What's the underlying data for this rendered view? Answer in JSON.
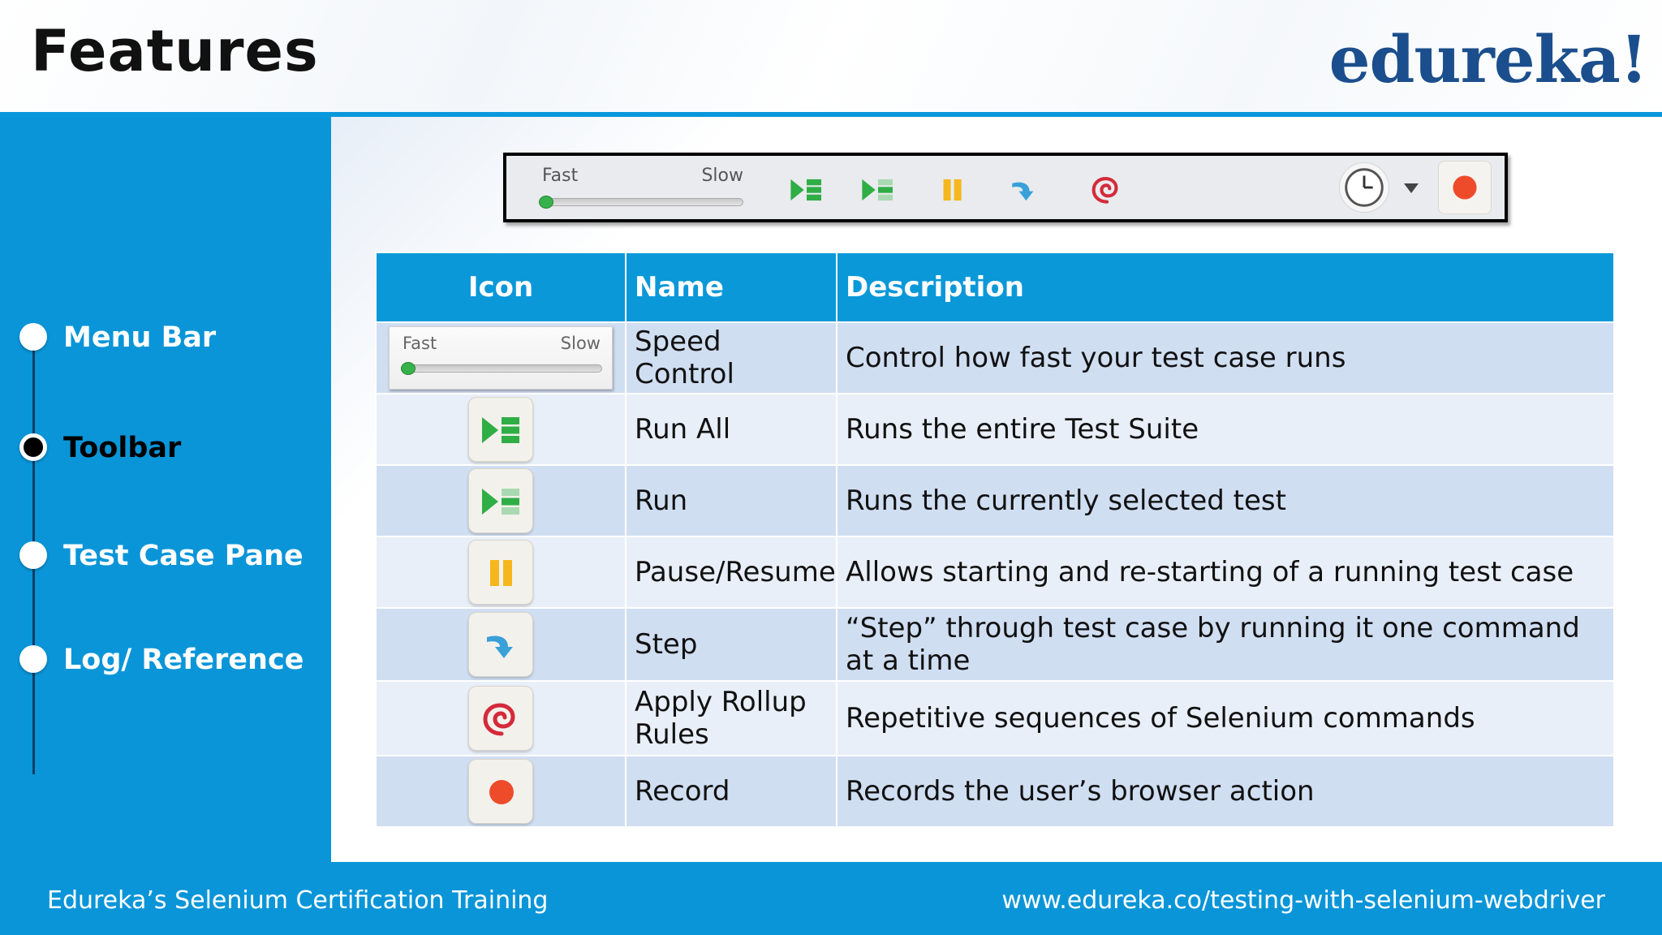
{
  "header": {
    "title": "Features",
    "logo": "edureka!"
  },
  "sidebar": {
    "items": [
      {
        "label": "Menu Bar",
        "active": false
      },
      {
        "label": "Toolbar",
        "active": true
      },
      {
        "label": "Test Case Pane",
        "active": false
      },
      {
        "label": "Log/ Reference",
        "active": false
      }
    ]
  },
  "toolbar": {
    "speed_fast": "Fast",
    "speed_slow": "Slow",
    "icons": [
      "run-all-icon",
      "run-icon",
      "pause-icon",
      "step-icon",
      "rollup-icon",
      "clock-icon",
      "dropdown-icon",
      "record-icon"
    ]
  },
  "table": {
    "headers": {
      "icon": "Icon",
      "name": "Name",
      "description": "Description"
    },
    "rows": [
      {
        "icon": "speed-control",
        "name": "Speed Control",
        "description": "Control how fast your test case runs"
      },
      {
        "icon": "run-all-icon",
        "name": "Run All",
        "description": "Runs the entire Test Suite"
      },
      {
        "icon": "run-icon",
        "name": "Run",
        "description": "Runs the currently selected test"
      },
      {
        "icon": "pause-icon",
        "name": "Pause/Resume",
        "description": "Allows starting and re-starting of a running test case"
      },
      {
        "icon": "step-icon",
        "name": "Step",
        "description": "“Step” through test case by running it one command at a time"
      },
      {
        "icon": "rollup-icon",
        "name": "Apply Rollup Rules",
        "description": "Repetitive sequences of Selenium commands"
      },
      {
        "icon": "record-icon",
        "name": "Record",
        "description": "Records the user’s browser action"
      }
    ]
  },
  "footer": {
    "left": "Edureka’s Selenium Certification Training",
    "right": "www.edureka.co/testing-with-selenium-webdriver"
  },
  "colors": {
    "accent": "#0a95d8",
    "table_header": "#0b98d9",
    "row_odd": "#d0def2",
    "row_even": "#e9eff8",
    "logo": "#1b4e8c",
    "record": "#ee4b2b"
  }
}
